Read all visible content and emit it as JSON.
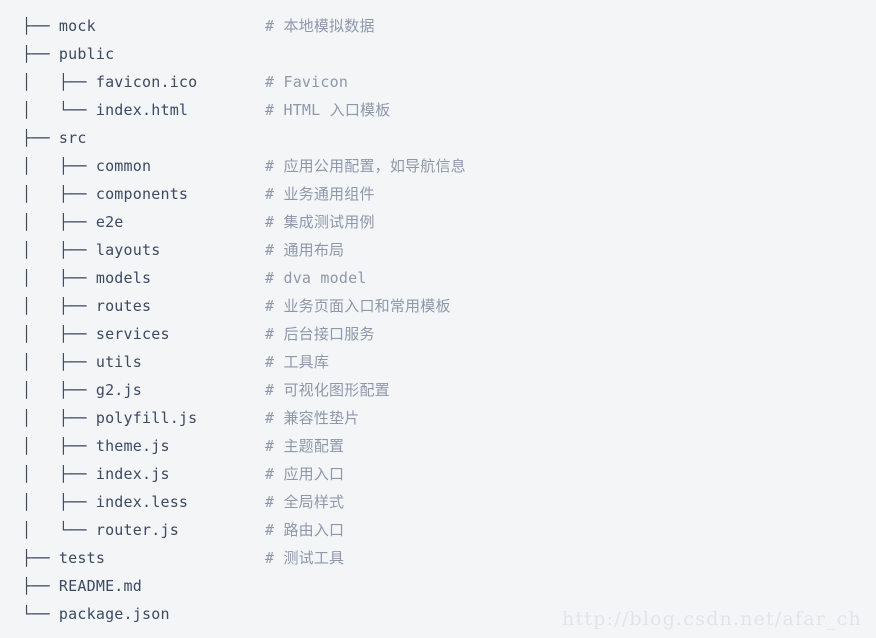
{
  "block": {
    "kind": "directory-tree-code-block",
    "background_color": "#f4f5f7",
    "path_color": "#3b4a63",
    "comment_color": "#8e98ab",
    "watermark_color": "#e2e4e8"
  },
  "watermark": {
    "text": "http://blog.csdn.net/afar_ch"
  },
  "tree": {
    "rows": [
      {
        "path": "├── mock",
        "comment": "# 本地模拟数据"
      },
      {
        "path": "├── public",
        "comment": ""
      },
      {
        "path": "│   ├── favicon.ico",
        "comment": "# Favicon"
      },
      {
        "path": "│   └── index.html",
        "comment": "# HTML 入口模板"
      },
      {
        "path": "├── src",
        "comment": ""
      },
      {
        "path": "│   ├── common",
        "comment": "# 应用公用配置，如导航信息"
      },
      {
        "path": "│   ├── components",
        "comment": "# 业务通用组件"
      },
      {
        "path": "│   ├── e2e",
        "comment": "# 集成测试用例"
      },
      {
        "path": "│   ├── layouts",
        "comment": "# 通用布局"
      },
      {
        "path": "│   ├── models",
        "comment": "# dva model"
      },
      {
        "path": "│   ├── routes",
        "comment": "# 业务页面入口和常用模板"
      },
      {
        "path": "│   ├── services",
        "comment": "# 后台接口服务"
      },
      {
        "path": "│   ├── utils",
        "comment": "# 工具库"
      },
      {
        "path": "│   ├── g2.js",
        "comment": "# 可视化图形配置"
      },
      {
        "path": "│   ├── polyfill.js",
        "comment": "# 兼容性垫片"
      },
      {
        "path": "│   ├── theme.js",
        "comment": "# 主题配置"
      },
      {
        "path": "│   ├── index.js",
        "comment": "# 应用入口"
      },
      {
        "path": "│   ├── index.less",
        "comment": "# 全局样式"
      },
      {
        "path": "│   └── router.js",
        "comment": "# 路由入口"
      },
      {
        "path": "├── tests",
        "comment": "# 测试工具"
      },
      {
        "path": "├── README.md",
        "comment": ""
      },
      {
        "path": "└── package.json",
        "comment": ""
      }
    ]
  }
}
